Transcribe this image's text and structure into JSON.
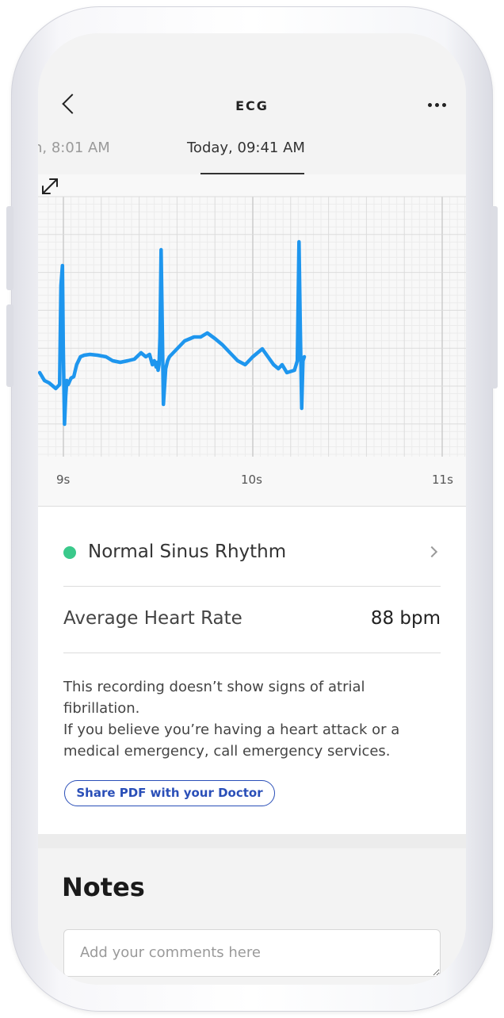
{
  "header": {
    "title": "ECG",
    "back_icon": "chevron-left-icon",
    "more_icon": "more-horizontal-icon"
  },
  "dates": {
    "previous": "n, 8:01 AM",
    "current": "Today, 09:41 AM"
  },
  "chart_data": {
    "type": "line",
    "title": "",
    "xlabel": "",
    "ylabel": "",
    "x_tick_labels": [
      "9s",
      "10s",
      "11s"
    ],
    "grid": true,
    "line_color": "#1E96EE",
    "expand_icon": "expand-icon",
    "series": [
      {
        "x": [
          8.875,
          8.9,
          8.925,
          8.96,
          8.98,
          8.987,
          8.995,
          8.999,
          9.006,
          9.012,
          9.018,
          9.025,
          9.04,
          9.055,
          9.07,
          9.09,
          9.11,
          9.14,
          9.18,
          9.225,
          9.26,
          9.3,
          9.34,
          9.375,
          9.41,
          9.435,
          9.455,
          9.47,
          9.48,
          9.49,
          9.495,
          9.5,
          9.505,
          9.51,
          9.516,
          9.522,
          9.528,
          9.54,
          9.55,
          9.56,
          9.58,
          9.6,
          9.64,
          9.69,
          9.725,
          9.76,
          9.8,
          9.84,
          9.88,
          9.92,
          9.96,
          10.0,
          10.05,
          10.08,
          10.11,
          10.135,
          10.155,
          10.18,
          10.22,
          10.235,
          10.244,
          10.25,
          10.258,
          10.265,
          10.272
        ],
        "y": [
          -0.15,
          -0.25,
          -0.28,
          -0.35,
          -0.3,
          0.95,
          1.2,
          0.2,
          -0.8,
          -0.45,
          -0.25,
          -0.3,
          -0.22,
          -0.2,
          -0.05,
          0.05,
          0.07,
          0.08,
          0.07,
          0.05,
          0.0,
          -0.02,
          0.0,
          0.02,
          0.1,
          0.05,
          0.08,
          -0.05,
          0.0,
          -0.08,
          -0.02,
          -0.12,
          -0.05,
          0.3,
          1.4,
          0.4,
          -0.55,
          -0.1,
          0.0,
          0.05,
          0.1,
          0.15,
          0.25,
          0.3,
          0.3,
          0.35,
          0.28,
          0.2,
          0.1,
          0.0,
          -0.05,
          0.05,
          0.15,
          0.05,
          -0.05,
          -0.1,
          -0.05,
          -0.15,
          -0.12,
          0.0,
          1.5,
          0.5,
          -0.6,
          0.0,
          0.05
        ]
      }
    ]
  },
  "result": {
    "dot_color": "#3AC98B",
    "rhythm_label": "Normal Sinus Rhythm",
    "chevron_icon": "chevron-right-icon",
    "heart_rate_label": "Average Heart Rate",
    "heart_rate_value": "88 bpm",
    "info_lines": [
      "This recording doesn’t show signs of atrial",
      "fibrillation.",
      "If you believe you’re having a heart attack or a",
      "medical emergency, call emergency services."
    ],
    "share_button_label": "Share PDF with your Doctor",
    "accent_color": "#2A4FB8"
  },
  "notes": {
    "title": "Notes",
    "placeholder": "Add your comments here"
  }
}
